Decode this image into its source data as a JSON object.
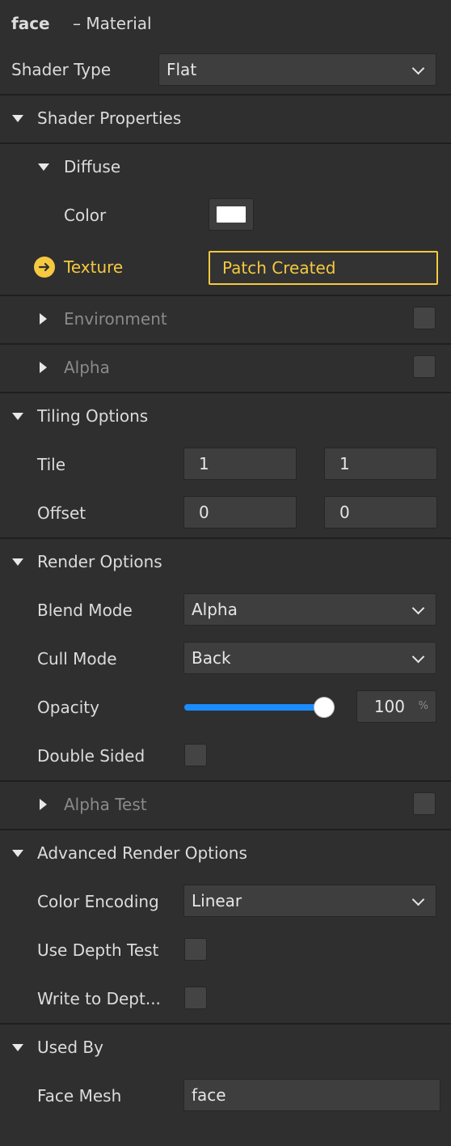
{
  "header": {
    "name": "face",
    "type": "– Material"
  },
  "shader_type": {
    "label": "Shader Type",
    "value": "Flat"
  },
  "shader_properties": {
    "title": "Shader Properties",
    "diffuse": {
      "title": "Diffuse",
      "color_label": "Color",
      "color_value": "#ffffff",
      "texture_label": "Texture",
      "texture_value": "Patch Created"
    },
    "environment": {
      "title": "Environment",
      "enabled": false
    },
    "alpha": {
      "title": "Alpha",
      "enabled": false
    }
  },
  "tiling": {
    "title": "Tiling Options",
    "tile_label": "Tile",
    "tile_u": "1",
    "tile_v": "1",
    "offset_label": "Offset",
    "offset_u": "0",
    "offset_v": "0"
  },
  "render": {
    "title": "Render Options",
    "blend_label": "Blend Mode",
    "blend_value": "Alpha",
    "cull_label": "Cull Mode",
    "cull_value": "Back",
    "opacity_label": "Opacity",
    "opacity_value": "100",
    "opacity_unit": "%",
    "opacity_fraction": 1.0,
    "double_sided_label": "Double Sided",
    "double_sided": false
  },
  "alpha_test": {
    "title": "Alpha Test",
    "enabled": false
  },
  "advanced": {
    "title": "Advanced Render Options",
    "encoding_label": "Color Encoding",
    "encoding_value": "Linear",
    "depth_test_label": "Use Depth Test",
    "depth_test": false,
    "depth_write_label": "Write to Dept...",
    "depth_write": false
  },
  "used_by": {
    "title": "Used By",
    "mesh_label": "Face Mesh",
    "mesh_value": "face"
  },
  "colors": {
    "accent_yellow": "#f5c940",
    "slider_blue": "#1a8cff",
    "panel_bg": "#2f2f2f",
    "field_bg": "#3e3e3e"
  }
}
